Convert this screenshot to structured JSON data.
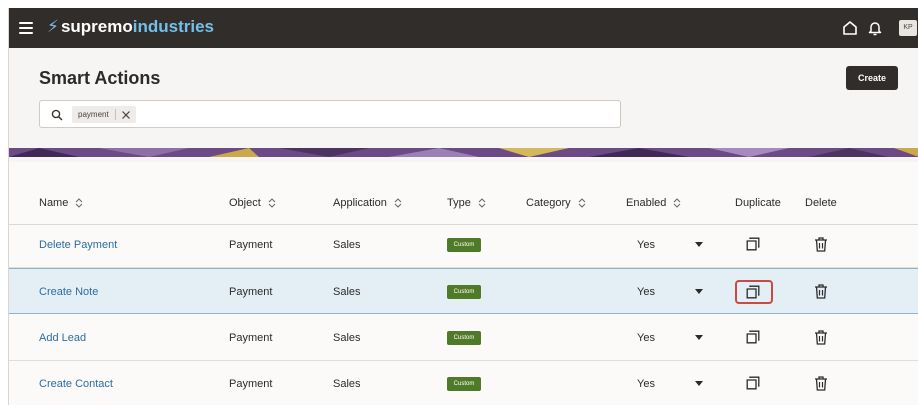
{
  "app": {
    "logo_part1": "supremo",
    "logo_part2": "industries",
    "avatar_initials": "KP"
  },
  "page": {
    "title": "Smart Actions",
    "create_label": "Create"
  },
  "search": {
    "chip_value": "payment"
  },
  "table": {
    "headers": {
      "name": "Name",
      "object": "Object",
      "application": "Application",
      "type": "Type",
      "category": "Category",
      "enabled": "Enabled",
      "duplicate": "Duplicate",
      "delete": "Delete"
    },
    "rows": [
      {
        "name": "Delete Payment",
        "object": "Payment",
        "application": "Sales",
        "type": "Custom",
        "category": "",
        "enabled": "Yes"
      },
      {
        "name": "Create Note",
        "object": "Payment",
        "application": "Sales",
        "type": "Custom",
        "category": "",
        "enabled": "Yes"
      },
      {
        "name": "Add Lead",
        "object": "Payment",
        "application": "Sales",
        "type": "Custom",
        "category": "",
        "enabled": "Yes"
      },
      {
        "name": "Create Contact",
        "object": "Payment",
        "application": "Sales",
        "type": "Custom",
        "category": "",
        "enabled": "Yes"
      }
    ],
    "selected_row": 1
  },
  "colors": {
    "topbar": "#312d2a",
    "logo_accent": "#72c0ea",
    "link": "#2c6d9e",
    "badge": "#4f7a28",
    "selected_row": "#e4eef5",
    "highlight_outline": "#c94a43"
  }
}
